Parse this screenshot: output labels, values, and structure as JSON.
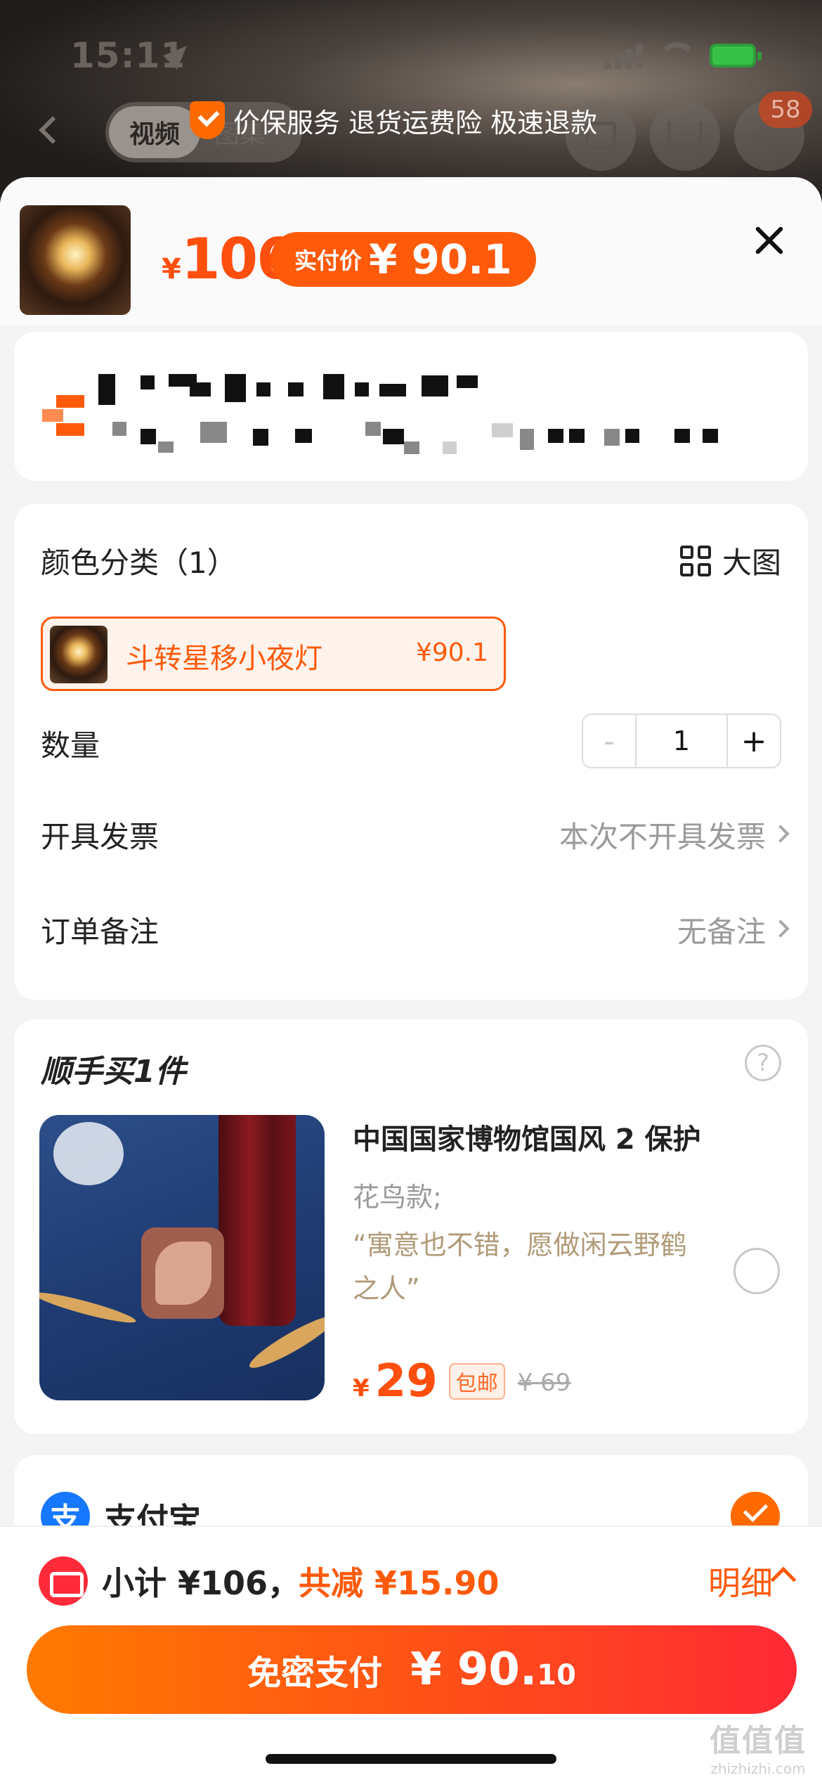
{
  "status_bar": {
    "time": "15:11"
  },
  "nav": {
    "tabs": [
      "视频",
      "图集"
    ],
    "service_banner": "价保服务 退货运费险 极速退款",
    "cart_badge": "58"
  },
  "product": {
    "currency": "¥",
    "price": "106",
    "pay_price_label": "实付价",
    "pay_price_value": "¥ 90.1"
  },
  "options": {
    "color_label": "颜色分类（1）",
    "big_image_label": "大图",
    "sku": {
      "name": "斗转星移小夜灯",
      "price": "¥90.1"
    },
    "quantity_label": "数量",
    "quantity_minus": "-",
    "quantity_value": "1",
    "quantity_plus": "+",
    "invoice_label": "开具发票",
    "invoice_value": "本次不开具发票",
    "note_label": "订单备注",
    "note_value": "无备注"
  },
  "addon": {
    "title": "顺手买1件",
    "help": "?",
    "name": "中国国家博物馆国风 2 保护",
    "sku": "花鸟款;",
    "quote": "“寓意也不错，愿做闲云野鹤之人”",
    "currency": "¥",
    "price": "29",
    "free_shipping": "包邮",
    "original_price": "¥ 69"
  },
  "payment": {
    "method": "支付宝",
    "icon_char": "支"
  },
  "summary": {
    "subtotal": "小计 ¥106，",
    "saved": "共减 ¥15.90",
    "detail": "明细",
    "pay_button_label": "免密支付",
    "pay_button_amount": "¥ 90.",
    "pay_button_cents": "10"
  },
  "watermark": {
    "cn": "值值值",
    "url": "zhizhizhi.com"
  },
  "colors": {
    "accent": "#ff5a0a",
    "alipay": "#1677ff",
    "coupon": "#ff2b3a"
  }
}
